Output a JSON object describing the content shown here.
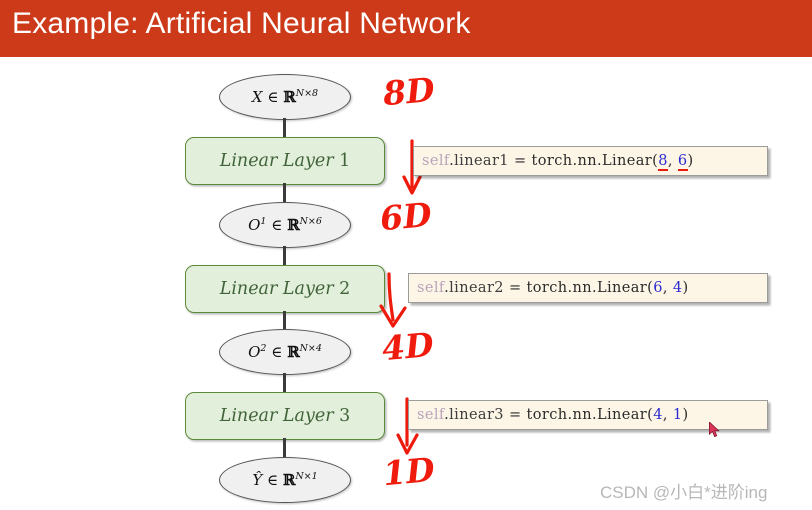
{
  "slide": {
    "title": "Example: Artificial Neural Network",
    "title_bar_color": "#cc3a19",
    "background_color": "#ffffff"
  },
  "flowchart": {
    "nodes": [
      {
        "id": "input",
        "type": "ellipse",
        "symbol": "X",
        "superscript": "",
        "set": "∈",
        "space": "ℝ",
        "dims": "N×8"
      },
      {
        "id": "layer1",
        "type": "box",
        "label": "Linear Layer",
        "number": "1"
      },
      {
        "id": "o1",
        "type": "ellipse",
        "symbol": "O",
        "superscript": "1",
        "set": "∈",
        "space": "ℝ",
        "dims": "N×6"
      },
      {
        "id": "layer2",
        "type": "box",
        "label": "Linear Layer",
        "number": "2"
      },
      {
        "id": "o2",
        "type": "ellipse",
        "symbol": "O",
        "superscript": "2",
        "set": "∈",
        "space": "ℝ",
        "dims": "N×4"
      },
      {
        "id": "layer3",
        "type": "box",
        "label": "Linear Layer",
        "number": "3"
      },
      {
        "id": "output",
        "type": "ellipse",
        "symbol": "Ŷ",
        "superscript": "",
        "set": "∈",
        "space": "ℝ",
        "dims": "N×1"
      }
    ],
    "box_fill": "#e2efda",
    "box_border": "#5b8a3c",
    "box_text_color": "#41633a",
    "ellipse_fill": "#f0f0f0",
    "ellipse_border": "#555555"
  },
  "code_callouts": [
    {
      "id": "code1",
      "self": "self",
      "dot1": ".",
      "attr": "linear1",
      "equals": " = ",
      "module": "torch.nn.Linear",
      "open": "(",
      "arg_in": "8",
      "comma": ",",
      "arg_out": "6",
      "close": ")",
      "args_underlined": true,
      "full_text": "self.linear1 = torch.nn.Linear(8, 6)"
    },
    {
      "id": "code2",
      "self": "self",
      "dot1": ".",
      "attr": "linear2",
      "equals": " = ",
      "module": "torch.nn.Linear",
      "open": "(",
      "arg_in": "6",
      "comma": ",",
      "arg_out": "4",
      "close": ")",
      "args_underlined": false,
      "full_text": "self.linear2 = torch.nn.Linear(6, 4)"
    },
    {
      "id": "code3",
      "self": "self",
      "dot1": ".",
      "attr": "linear3",
      "equals": " = ",
      "module": "torch.nn.Linear",
      "open": "(",
      "arg_in": "4",
      "comma": ",",
      "arg_out": "1",
      "close": ")",
      "args_underlined": false,
      "full_text": "self.linear3 = torch.nn.Linear(4, 1)"
    }
  ],
  "annotations": {
    "color": "#ef1b0c",
    "items": [
      {
        "id": "ann8d",
        "text": "8D"
      },
      {
        "id": "ann6d",
        "text": "6D"
      },
      {
        "id": "ann4d",
        "text": "4D"
      },
      {
        "id": "ann1d",
        "text": "1D"
      }
    ]
  },
  "watermark": {
    "text": "CSDN @小白*进阶ing",
    "color": "#b7b7b7"
  }
}
